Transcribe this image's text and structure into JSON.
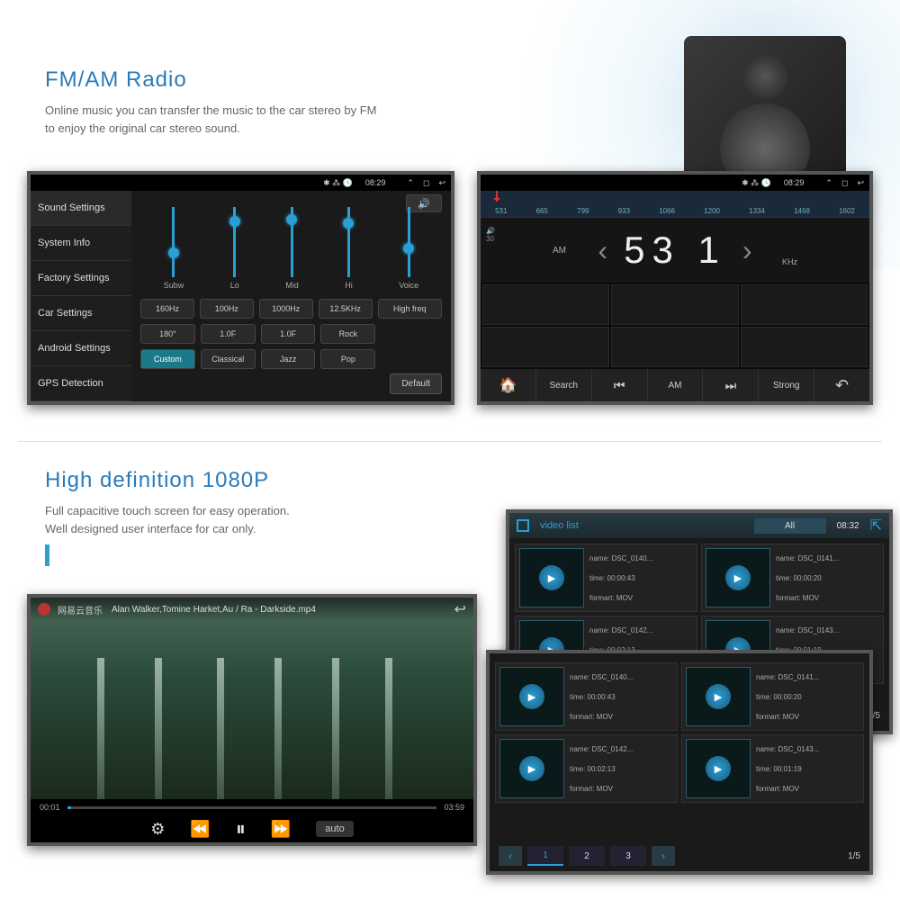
{
  "section1": {
    "title": "FM/AM Radio",
    "desc": "Online music you can transfer the music to the car stereo by FM to enjoy the original car stereo sound."
  },
  "section2": {
    "title": "High definition 1080P",
    "desc1": "Full capacitive touch screen for easy operation.",
    "desc2": "Well designed user interface for car only."
  },
  "statusbar": {
    "time1": "08:29",
    "time2": "08:29"
  },
  "settings": {
    "menu": [
      "Sound Settings",
      "System Info",
      "Factory Settings",
      "Car Settings",
      "Android Settings",
      "GPS Detection"
    ],
    "eq_labels": [
      "Subw",
      "Lo",
      "Mid",
      "Hi",
      "Voice"
    ],
    "eq_positions": [
      45,
      10,
      8,
      12,
      40
    ],
    "row1": [
      "160Hz",
      "100Hz",
      "1000Hz",
      "12.5KHz",
      "High freq"
    ],
    "row2": [
      "180°",
      "1.0F",
      "1.0F",
      "Rock"
    ],
    "row3": [
      "Custom",
      "Classical",
      "Jazz",
      "Pop"
    ],
    "default": "Default"
  },
  "radio": {
    "ticks": [
      "531",
      "665",
      "799",
      "933",
      "1066",
      "1200",
      "1334",
      "1468",
      "1602"
    ],
    "band": "AM",
    "freq": "53 1",
    "unit": "KHz",
    "vol": "30",
    "controls": {
      "home": "⌂",
      "search": "Search",
      "prev": "⏮",
      "band_btn": "AM",
      "next": "⏭",
      "strong": "Strong",
      "back": "↶"
    }
  },
  "video": {
    "brand": "网易云音乐",
    "title": "Alan Walker,Tomine Harket,Au / Ra - Darkside.mp4",
    "current": "00:01",
    "total": "03:59",
    "auto": "auto"
  },
  "vlist": {
    "header_title": "video list",
    "all": "All",
    "time": "08:32",
    "items": [
      {
        "name": "name: DSC_0140...",
        "time": "time:  00:00:43",
        "format": "formart:  MOV"
      },
      {
        "name": "name: DSC_0141...",
        "time": "time:  00:00:20",
        "format": "formart:  MOV"
      },
      {
        "name": "name: DSC_0142...",
        "time": "time:  00:02:13",
        "format": "formart:  MOV"
      },
      {
        "name": "name: DSC_0143...",
        "time": "time:  00:01:19",
        "format": "formart:  MOV"
      }
    ],
    "pages": [
      "1",
      "2",
      "3"
    ],
    "page_total": "1/5"
  }
}
